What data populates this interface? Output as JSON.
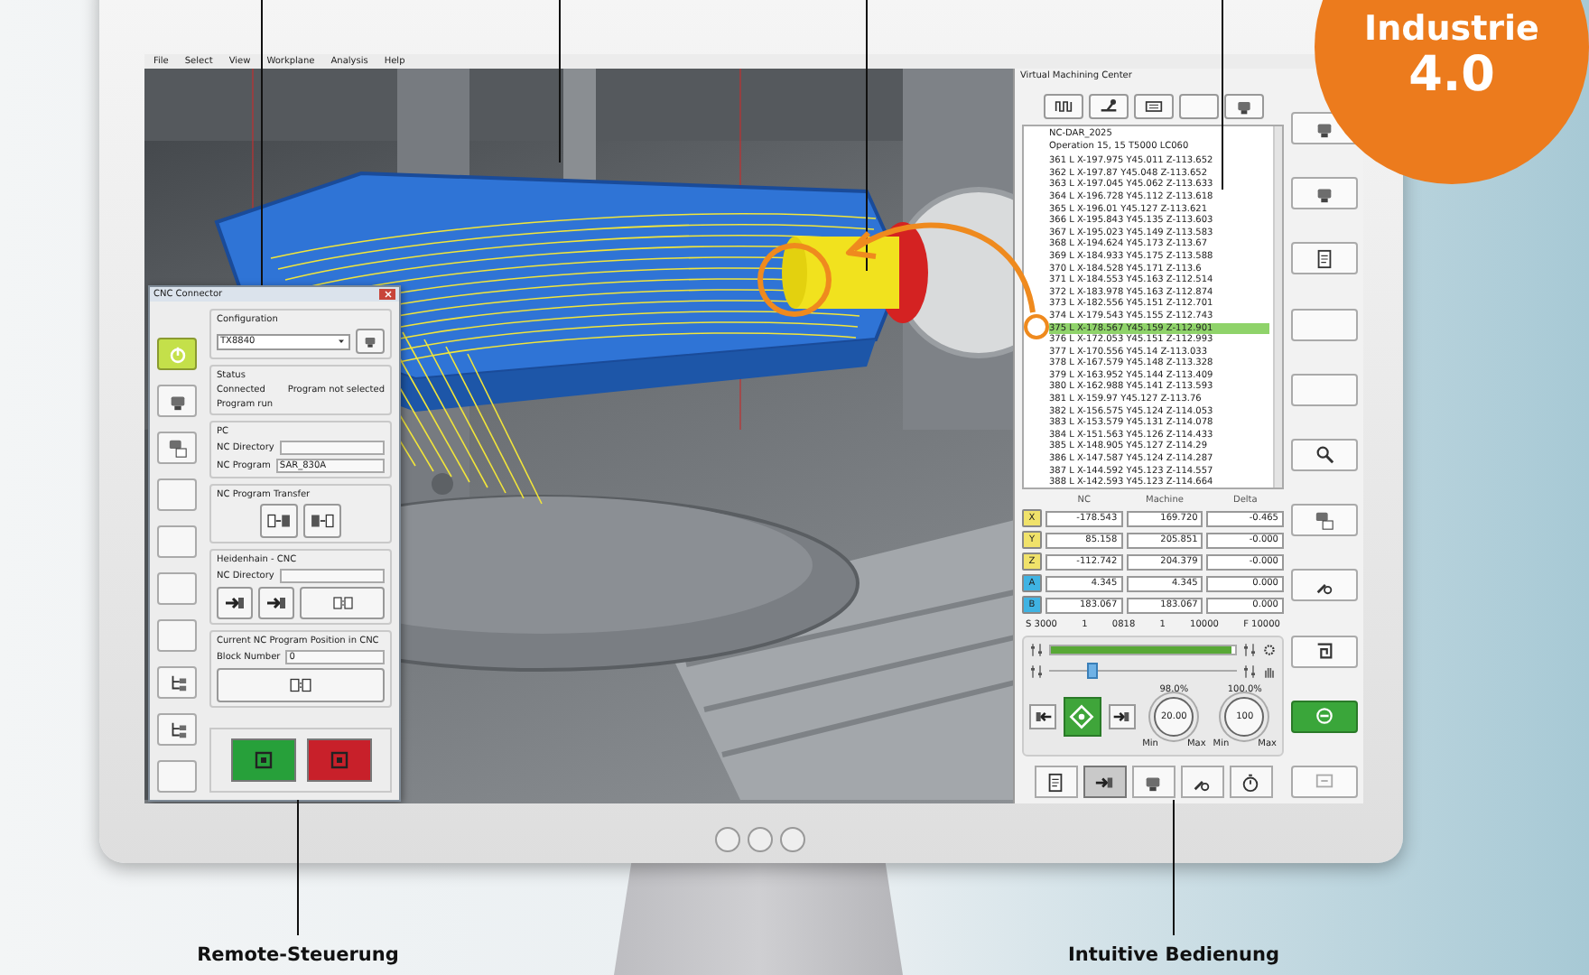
{
  "badge": {
    "title": "Industrie",
    "version": "4.0"
  },
  "menu": [
    "File",
    "Select",
    "View",
    "Workplane",
    "Analysis",
    "Help"
  ],
  "cnc_connector": {
    "title": "CNC Connector",
    "side_buttons": [
      {
        "kind": "power",
        "active": true
      },
      {
        "kind": "machine",
        "active": false
      },
      {
        "kind": "machine-document",
        "active": false
      },
      {
        "kind": "blank",
        "active": false
      },
      {
        "kind": "blank",
        "active": false
      },
      {
        "kind": "blank",
        "active": false
      },
      {
        "kind": "blank",
        "active": false
      },
      {
        "kind": "tree",
        "active": false
      },
      {
        "kind": "tree",
        "active": false
      },
      {
        "kind": "blank",
        "active": false
      }
    ],
    "configuration": {
      "title": "Configuration",
      "value": "TX8840"
    },
    "status": {
      "title": "Status",
      "connection": "Connected",
      "program": "Program not selected",
      "run_state": "Program run"
    },
    "pc": {
      "title": "PC",
      "directory_label": "NC Directory",
      "program_label": "NC Program",
      "program_value": "SAR_830A"
    },
    "transfer": {
      "title": "NC Program Transfer"
    },
    "cnc": {
      "title": "Heidenhain - CNC",
      "directory_label": "NC Directory"
    },
    "position": {
      "title": "Current NC Program Position in CNC",
      "block_label": "Block Number",
      "block_value": "0"
    }
  },
  "vmc": {
    "title": "Virtual Machining Center",
    "tabs": [
      {
        "kind": "wave"
      },
      {
        "kind": "network"
      },
      {
        "kind": "display"
      },
      {
        "kind": "blank"
      },
      {
        "kind": "machine"
      }
    ],
    "program_header": [
      "NC-DAR_2025",
      "Operation 15, 15 T5000 LC060"
    ],
    "program_lines": [
      {
        "text": "361 L X-197.975 Y45.011 Z-113.652",
        "selected": false
      },
      {
        "text": "362 L X-197.87 Y45.048 Z-113.652",
        "selected": false
      },
      {
        "text": "363 L X-197.045 Y45.062 Z-113.633",
        "selected": false
      },
      {
        "text": "364 L X-196.728 Y45.112 Z-113.618",
        "selected": false
      },
      {
        "text": "365 L X-196.01 Y45.127 Z-113.621",
        "selected": false
      },
      {
        "text": "366 L X-195.843 Y45.135 Z-113.603",
        "selected": false
      },
      {
        "text": "367 L X-195.023 Y45.149 Z-113.583",
        "selected": false
      },
      {
        "text": "368 L X-194.624 Y45.173 Z-113.67",
        "selected": false
      },
      {
        "text": "369 L X-184.933 Y45.175 Z-113.588",
        "selected": false
      },
      {
        "text": "370 L X-184.528 Y45.171 Z-113.6",
        "selected": false
      },
      {
        "text": "371 L X-184.553 Y45.163 Z-112.514",
        "selected": false
      },
      {
        "text": "372 L X-183.978 Y45.163 Z-112.874",
        "selected": false
      },
      {
        "text": "373 L X-182.556 Y45.151 Z-112.701",
        "selected": false
      },
      {
        "text": "374 L X-179.543 Y45.155 Z-112.743",
        "selected": false
      },
      {
        "text": "375 L X-178.567 Y45.159 Z-112.901",
        "selected": true
      },
      {
        "text": "376 L X-172.053 Y45.151 Z-112.993",
        "selected": false
      },
      {
        "text": "377 L X-170.556 Y45.14 Z-113.033",
        "selected": false
      },
      {
        "text": "378 L X-167.579 Y45.148 Z-113.328",
        "selected": false
      },
      {
        "text": "379 L X-163.952 Y45.144 Z-113.409",
        "selected": false
      },
      {
        "text": "380 L X-162.988 Y45.141 Z-113.593",
        "selected": false
      },
      {
        "text": "381 L X-159.97 Y45.127 Z-113.76",
        "selected": false
      },
      {
        "text": "382 L X-156.575 Y45.124 Z-114.053",
        "selected": false
      },
      {
        "text": "383 L X-153.579 Y45.131 Z-114.078",
        "selected": false
      },
      {
        "text": "384 L X-151.563 Y45.126 Z-114.433",
        "selected": false
      },
      {
        "text": "385 L X-148.905 Y45.127 Z-114.29",
        "selected": false
      },
      {
        "text": "386 L X-147.587 Y45.124 Z-114.287",
        "selected": false
      },
      {
        "text": "387 L X-144.592 Y45.123 Z-114.557",
        "selected": false
      },
      {
        "text": "388 L X-142.593 Y45.123 Z-114.664",
        "selected": false
      }
    ],
    "columns": [
      "NC",
      "Machine",
      "Delta"
    ],
    "axes": [
      {
        "name": "X",
        "color": "#f0e26a",
        "nc": "-178.543",
        "machine": "169.720",
        "delta": "-0.465"
      },
      {
        "name": "Y",
        "color": "#f0e26a",
        "nc": "85.158",
        "machine": "205.851",
        "delta": "-0.000"
      },
      {
        "name": "Z",
        "color": "#f0e26a",
        "nc": "-112.742",
        "machine": "204.379",
        "delta": "-0.000"
      },
      {
        "name": "A",
        "color": "#3fb3e3",
        "nc": "4.345",
        "machine": "4.345",
        "delta": "0.000"
      },
      {
        "name": "B",
        "color": "#3fb3e3",
        "nc": "183.067",
        "machine": "183.067",
        "delta": "0.000"
      }
    ],
    "status_items": [
      "S 3000",
      "1",
      "0818",
      "1",
      "10000",
      "F 10000"
    ],
    "feed_override": {
      "level": 0.98
    },
    "spindle_override": {
      "level": 0.22
    },
    "dials": [
      {
        "label": "98.0%",
        "value": "20.00",
        "min": "Min",
        "max": "Max"
      },
      {
        "label": "100.0%",
        "value": "100",
        "min": "Min",
        "max": "Max"
      }
    ],
    "bottom_tabs": [
      {
        "kind": "document",
        "selected": false
      },
      {
        "kind": "arrow",
        "selected": true
      },
      {
        "kind": "machine",
        "selected": false
      },
      {
        "kind": "wrench",
        "selected": false
      },
      {
        "kind": "stopwatch",
        "selected": false
      }
    ],
    "side_buttons": [
      {
        "kind": "machine",
        "active": false
      },
      {
        "kind": "machine",
        "active": false
      },
      {
        "kind": "document",
        "active": false
      },
      {
        "kind": "blank",
        "active": false
      },
      {
        "kind": "blank",
        "active": false
      },
      {
        "kind": "search",
        "active": false
      },
      {
        "kind": "machine-document",
        "active": false
      },
      {
        "kind": "wrench",
        "active": false
      },
      {
        "kind": "loop",
        "active": false
      },
      {
        "kind": "minus",
        "active": true
      },
      {
        "kind": "frame",
        "active": false
      }
    ]
  },
  "callouts": [
    "Remote-Steuerung",
    "Intuitive Bedienung"
  ]
}
